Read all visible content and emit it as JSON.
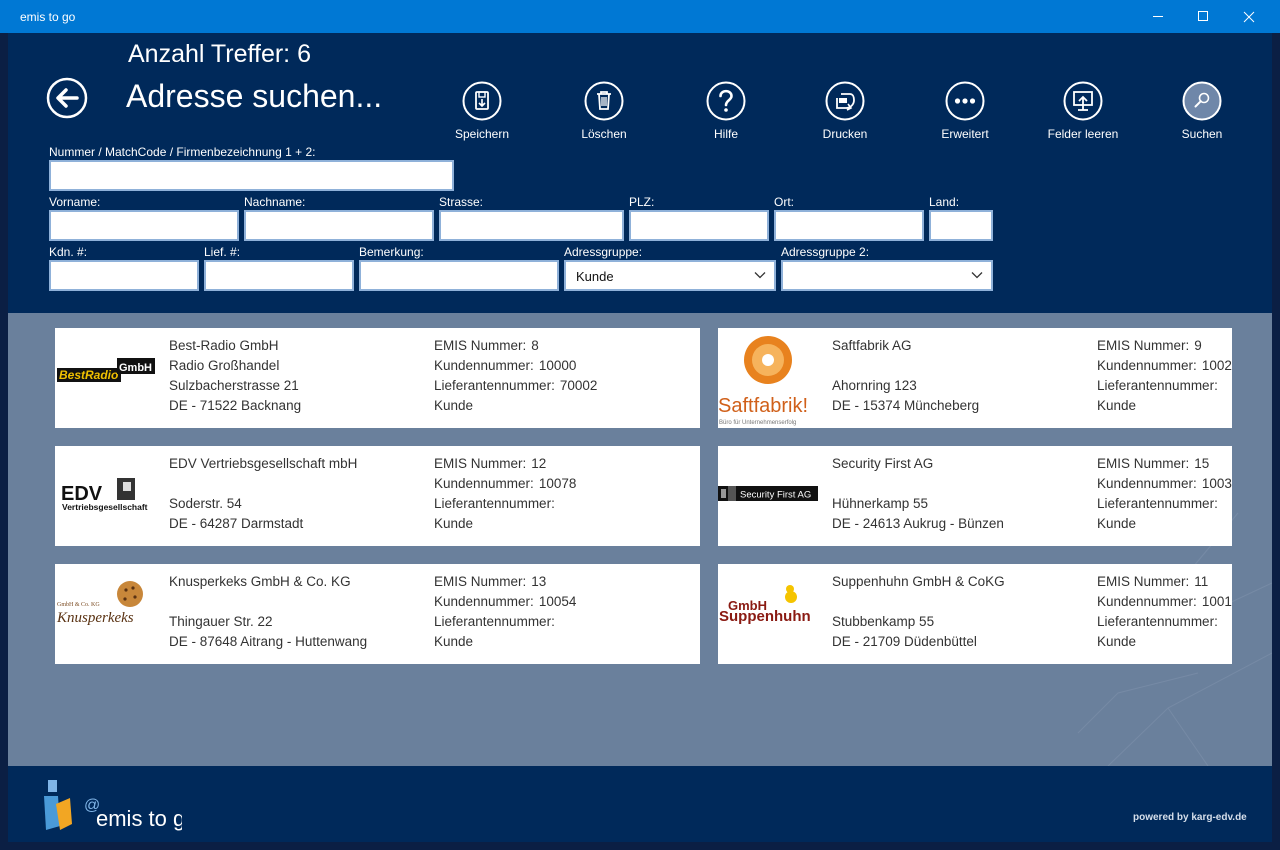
{
  "window": {
    "title": "emis to go"
  },
  "header": {
    "hits": "Anzahl Treffer: 6",
    "title": "Adresse suchen...",
    "toolbar": [
      {
        "label": "Speichern",
        "icon": "save-icon"
      },
      {
        "label": "Löschen",
        "icon": "trash-icon"
      },
      {
        "label": "Hilfe",
        "icon": "help-icon"
      },
      {
        "label": "Drucken",
        "icon": "print-icon"
      },
      {
        "label": "Erweitert",
        "icon": "more-icon"
      },
      {
        "label": "Felder leeren",
        "icon": "clear-fields-icon"
      },
      {
        "label": "Suchen",
        "icon": "search-icon"
      }
    ]
  },
  "form": {
    "matchcode": {
      "label": "Nummer / MatchCode / Firmenbezeichnung 1 + 2:",
      "value": ""
    },
    "vorname": {
      "label": "Vorname:",
      "value": ""
    },
    "nachname": {
      "label": "Nachname:",
      "value": ""
    },
    "strasse": {
      "label": "Strasse:",
      "value": ""
    },
    "plz": {
      "label": "PLZ:",
      "value": ""
    },
    "ort": {
      "label": "Ort:",
      "value": ""
    },
    "land": {
      "label": "Land:",
      "value": ""
    },
    "kdn": {
      "label": "Kdn. #:",
      "value": ""
    },
    "lief": {
      "label": "Lief. #:",
      "value": ""
    },
    "bemerkung": {
      "label": "Bemerkung:",
      "value": ""
    },
    "adressgruppe": {
      "label": "Adressgruppe:",
      "value": "Kunde"
    },
    "adressgruppe2": {
      "label": "Adressgruppe 2:",
      "value": ""
    }
  },
  "results": [
    {
      "logo": "BestRadio GmbH",
      "name": "Best-Radio GmbH",
      "line2": "Radio Großhandel",
      "street": "Sulzbacherstrasse 21",
      "city": "DE - 71522 Backnang",
      "emis_label": "EMIS Nummer:",
      "emis": "8",
      "kunde_label": "Kundennummer:",
      "kunde": "10000",
      "lief_label": "Lieferantennummer:",
      "lief": "70002",
      "group": "Kunde"
    },
    {
      "logo": "Saftfabrik!",
      "logo_sub": "Büro für Unternehmenserfolg",
      "name": "Saftfabrik AG",
      "line2": "",
      "street": "Ahornring 123",
      "city": "DE - 15374 Müncheberg",
      "emis_label": "EMIS Nummer:",
      "emis": "9",
      "kunde_label": "Kundennummer:",
      "kunde": "1002",
      "lief_label": "Lieferantennummer:",
      "lief": "",
      "group": "Kunde"
    },
    {
      "logo": "EDV",
      "logo_sub": "Vertriebsgesellschaft",
      "name": "EDV Vertriebsgesellschaft mbH",
      "line2": "",
      "street": "Soderstr. 54",
      "city": "DE - 64287 Darmstadt",
      "emis_label": "EMIS Nummer:",
      "emis": "12",
      "kunde_label": "Kundennummer:",
      "kunde": "10078",
      "lief_label": "Lieferantennummer:",
      "lief": "",
      "group": "Kunde"
    },
    {
      "logo": "Security First AG",
      "name": "Security First AG",
      "line2": "",
      "street": "Hühnerkamp 55",
      "city": "DE - 24613 Aukrug - Bünzen",
      "emis_label": "EMIS Nummer:",
      "emis": "15",
      "kunde_label": "Kundennummer:",
      "kunde": "1003",
      "lief_label": "Lieferantennummer:",
      "lief": "",
      "group": "Kunde"
    },
    {
      "logo": "Knusperkeks",
      "logo_sub": "GmbH & Co. KG",
      "name": "Knusperkeks GmbH & Co. KG",
      "line2": "",
      "street": "Thingauer Str. 22",
      "city": "DE - 87648 Aitrang - Huttenwang",
      "emis_label": "EMIS Nummer:",
      "emis": "13",
      "kunde_label": "Kundennummer:",
      "kunde": "10054",
      "lief_label": "Lieferantennummer:",
      "lief": "",
      "group": "Kunde"
    },
    {
      "logo": "GmbH Suppenhuhn",
      "name": "Suppenhuhn GmbH & CoKG",
      "line2": "",
      "street": "Stubbenkamp 55",
      "city": "DE - 21709 Düdenbüttel",
      "emis_label": "EMIS Nummer:",
      "emis": "11",
      "kunde_label": "Kundennummer:",
      "kunde": "1001",
      "lief_label": "Lieferantennummer:",
      "lief": "",
      "group": "Kunde"
    }
  ],
  "footer": {
    "brand": "emis to go",
    "powered": "powered by karg-edv.de"
  },
  "colors": {
    "titlebar": "#0078d4",
    "header": "#00295a",
    "content": "#6a809c"
  }
}
